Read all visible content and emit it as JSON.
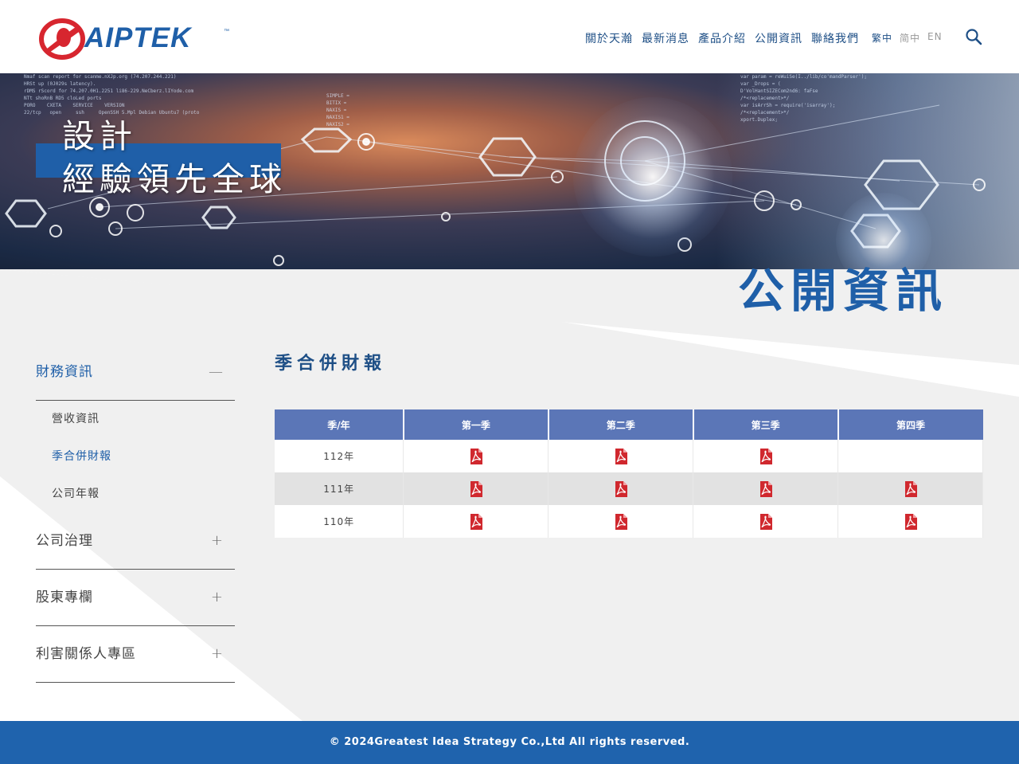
{
  "header": {
    "logo_text": "AIPTEK",
    "logo_tm": "™",
    "nav": [
      "關於天瀚",
      "最新消息",
      "產品介紹",
      "公開資訊",
      "聯絡我們"
    ],
    "lang": [
      "繁中",
      "简中",
      "EN"
    ],
    "active_lang": "繁中"
  },
  "banner": {
    "line1": "設計",
    "line2": "經驗領先全球",
    "code_lines_left": "Nmaf scan report for scanme.nXJp.org (74.207.244.221)\nHRSt up (0J029s latency).\nrDMS rScord for 74.207.0H1.2251 li86-229.NeCberz.lIYode.com\nNTt shoRnB RD5 cloLed ports\nPORO    CXETA    SERVICE    VERSION\n22/tcp   open     ssh     OpenSSH 5.Mpl Debian Ubuntu7 (proto",
    "code_lines_mid": "SIMPLE =\nBITIX =\nNAXIS =\nNAXIS1 =\nNAXIS2 =",
    "code_lines_right": "var param = reWuiSe(I../lib/co'mandParser');\nvar _Drops = (\nD'VolHantSIZECom2nd6: faFse\n/*<replacement>*/\nvar isArrSh = require('isarray');\n/*<replacement>*/\nxport.Duplex;"
  },
  "page_heading": "公開資訊",
  "sidebar": {
    "sections": [
      {
        "label": "財務資訊",
        "toggle": "—",
        "items": [
          "營收資訊",
          "季合併財報",
          "公司年報"
        ]
      },
      {
        "label": "公司治理",
        "toggle": "+"
      },
      {
        "label": "股東專欄",
        "toggle": "+"
      },
      {
        "label": "利害關係人專區",
        "toggle": "+"
      }
    ]
  },
  "content": {
    "title": "季合併財報",
    "columns": [
      "季/年",
      "第一季",
      "第二季",
      "第三季",
      "第四季"
    ],
    "rows": [
      {
        "year": "112年",
        "q": [
          true,
          true,
          true,
          false
        ]
      },
      {
        "year": "111年",
        "q": [
          true,
          true,
          true,
          true
        ]
      },
      {
        "year": "110年",
        "q": [
          true,
          true,
          true,
          true
        ]
      }
    ]
  },
  "colors": {
    "brand_blue": "#1f5fa8",
    "table_header": "#5b76b7",
    "pdf_red": "#d0282e"
  },
  "footer": {
    "text": "© 2024Greatest Idea Strategy Co.,Ltd All rights reserved."
  }
}
